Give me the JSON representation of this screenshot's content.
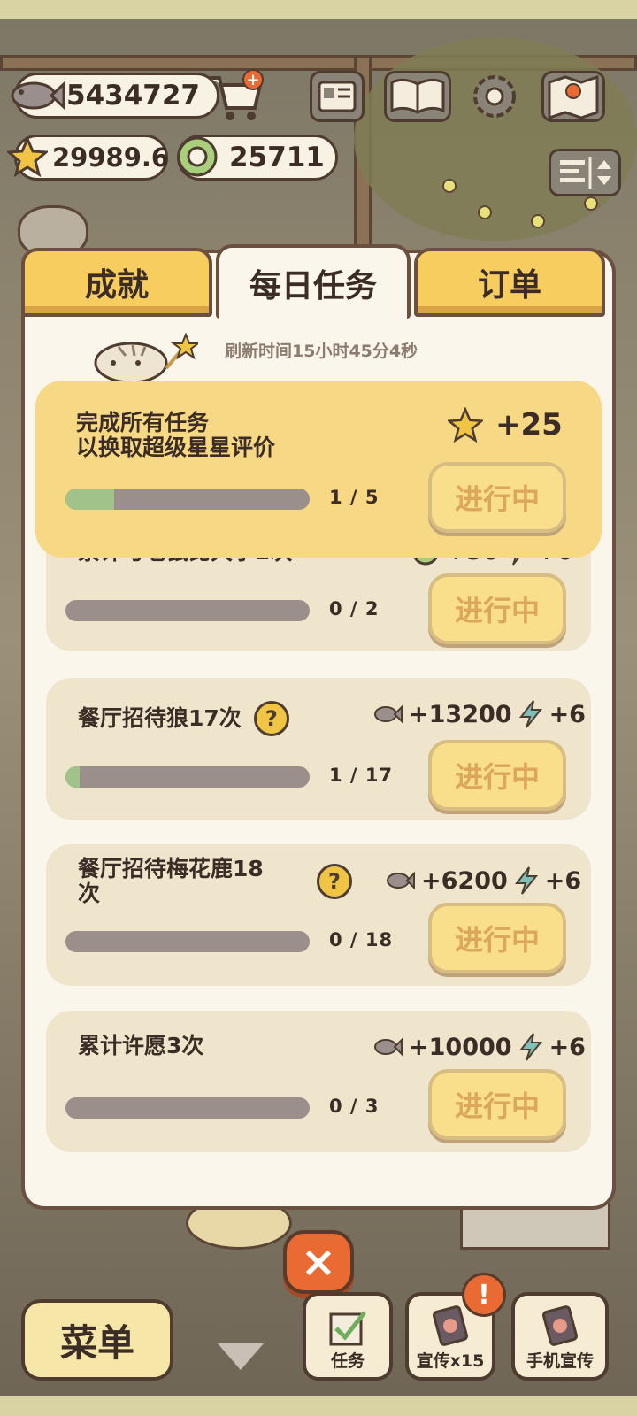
{
  "currency": {
    "fish": "5434727",
    "stars": "29989.6",
    "coins": "25711"
  },
  "tabs": [
    {
      "label": "成就",
      "active": false
    },
    {
      "label": "每日任务",
      "active": true
    },
    {
      "label": "订单",
      "active": false
    }
  ],
  "refresh_text": "刷新时间15小时45分4秒",
  "featured_task": {
    "title_line1": "完成所有任务",
    "title_line2": "以换取超级星星评价",
    "reward": "+25",
    "progress_text": "1  /  5",
    "progress": 0.2,
    "button": "进行中"
  },
  "tasks": [
    {
      "title": "累计与老鼠比大小2次",
      "reward_main": "+50",
      "reward_bonus": "+6",
      "progress_text": "0  /  2",
      "progress": 0,
      "button": "进行中"
    },
    {
      "title": "餐厅招待狼17次",
      "help": "?",
      "reward_main": "+13200",
      "reward_bonus": "+6",
      "progress_text": "1  /  17",
      "progress": 0.0588,
      "button": "进行中"
    },
    {
      "title_line1": "餐厅招待梅花鹿18",
      "title_line2": "次",
      "help": "?",
      "reward_main": "+6200",
      "reward_bonus": "+6",
      "progress_text": "0  /  18",
      "progress": 0,
      "button": "进行中"
    },
    {
      "title": "累计许愿3次",
      "reward_main": "+10000",
      "reward_bonus": "+6",
      "progress_text": "0  /  3",
      "progress": 0,
      "button": "进行中"
    }
  ],
  "bottom": {
    "menu": "菜单",
    "close": "×",
    "tasks": "任务",
    "promote": "宣传x15",
    "phone_promote": "手机宣传",
    "alert": "!"
  },
  "colors": {
    "accent_yellow": "#f6cd5e",
    "card": "#efe5cd",
    "progress_fill": "#a1c38a",
    "close_orange": "#e96b33"
  }
}
